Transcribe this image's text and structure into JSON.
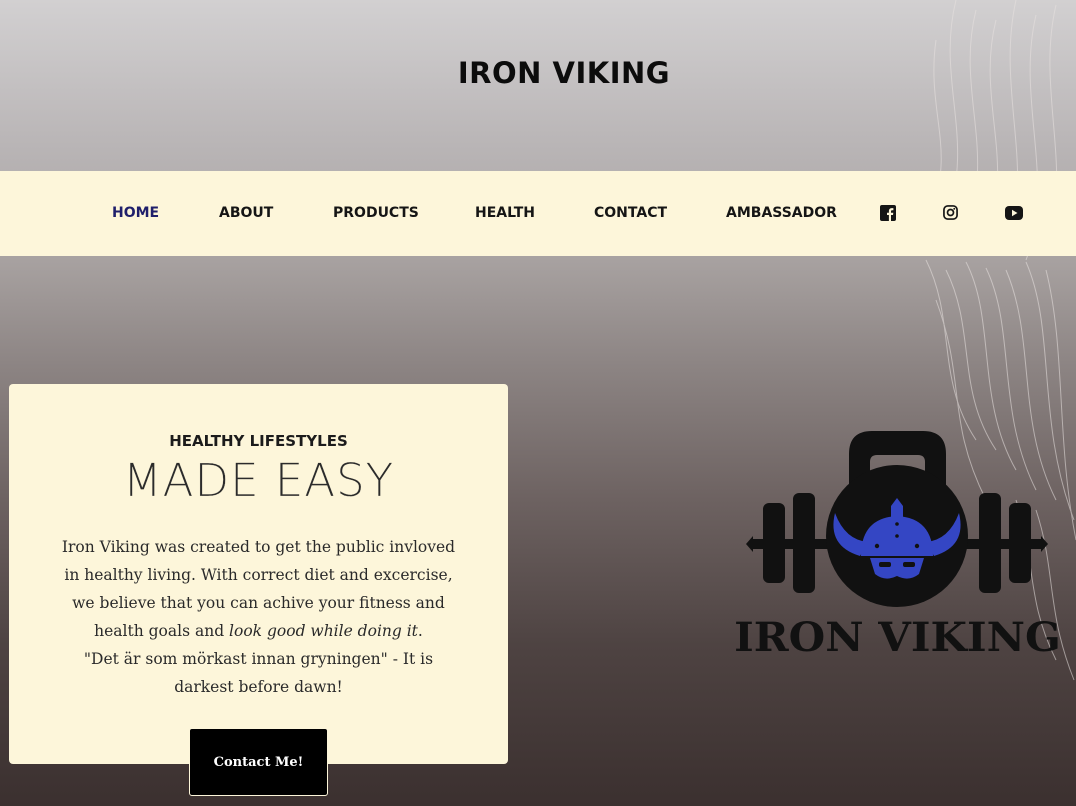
{
  "header": {
    "title": "IRON VIKING"
  },
  "nav": {
    "items": [
      {
        "label": "HOME",
        "active": true
      },
      {
        "label": "ABOUT"
      },
      {
        "label": "PRODUCTS"
      },
      {
        "label": "HEALTH"
      },
      {
        "label": "CONTACT"
      },
      {
        "label": "AMBASSADOR"
      }
    ],
    "social": [
      "facebook-icon",
      "instagram-icon",
      "youtube-icon"
    ]
  },
  "hero": {
    "kicker": "HEALTHY LIFESTYLES",
    "heading": "MADE EASY",
    "body_part1": "Iron Viking was created to get the public invloved in healthy living. With correct diet and excercise, we believe that you can achive your fitness and health goals and ",
    "body_italic": "look good while doing it",
    "body_part2": ".",
    "quote": "\"Det är som mörkast innan gryningen\" - It is darkest before dawn!",
    "button_label": "Contact Me!"
  },
  "logo": {
    "text": "IRON VIKING",
    "icon": "kettlebell-viking-helmet-icon",
    "accent_color": "#3446c4"
  },
  "colors": {
    "nav_bg": "#fdf6da",
    "active_link": "#1f1f6b"
  }
}
